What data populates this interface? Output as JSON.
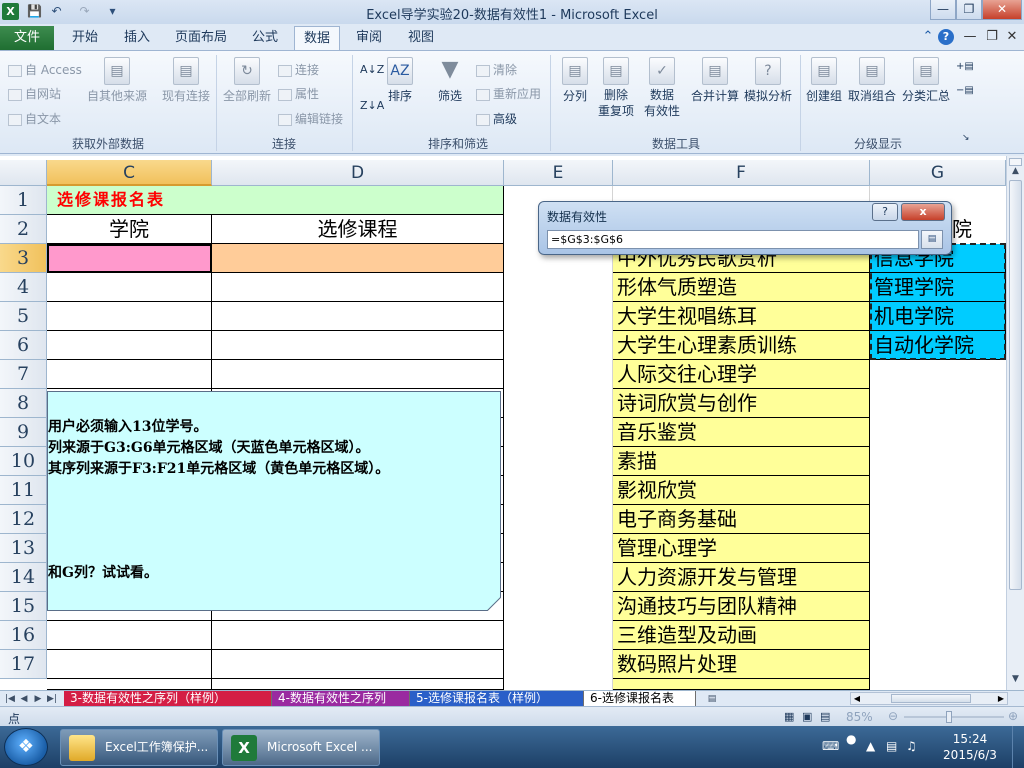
{
  "window": {
    "title": "Excel导学实验20-数据有效性1 - Microsoft Excel"
  },
  "ribbon_tabs": [
    "文件",
    "开始",
    "插入",
    "页面布局",
    "公式",
    "数据",
    "审阅",
    "视图"
  ],
  "active_tab": "数据",
  "ribbon": {
    "from_access": "自 Access",
    "from_web": "自网站",
    "from_text": "自文本",
    "other_sources": "自其他来源",
    "existing_connections": "现有连接",
    "group_external": "获取外部数据",
    "refresh_all": "全部刷新",
    "connections": "连接",
    "properties": "属性",
    "edit_links": "编辑链接",
    "group_connections": "连接",
    "sort": "排序",
    "filter": "筛选",
    "clear": "清除",
    "reapply": "重新应用",
    "advanced": "高级",
    "group_sort": "排序和筛选",
    "text_to_columns": "分列",
    "remove_duplicates_1": "删除",
    "remove_duplicates_2": "重复项",
    "data_validation_1": "数据",
    "data_validation_2": "有效性",
    "consolidate": "合并计算",
    "what_if": "模拟分析",
    "group_data_tools": "数据工具",
    "group": "创建组",
    "ungroup": "取消组合",
    "subtotal": "分类汇总",
    "group_outline": "分级显示"
  },
  "columns": [
    "C",
    "D",
    "E",
    "F",
    "G"
  ],
  "rows": [
    "1",
    "2",
    "3",
    "4",
    "5",
    "6",
    "7",
    "8",
    "9",
    "10",
    "11",
    "12",
    "13",
    "14",
    "15",
    "16",
    "17"
  ],
  "sheet": {
    "title_cell": "选修课报名表",
    "header_college": "学院",
    "header_course": "选修课程",
    "f_column": [
      "中外优秀民歌赏析",
      "形体气质塑造",
      "大学生视唱练耳",
      "大学生心理素质训练",
      "人际交往心理学",
      "诗词欣赏与创作",
      "音乐鉴赏",
      "素描",
      "影视欣赏",
      "电子商务基础",
      "管理心理学",
      "人力资源开发与管理",
      "沟通技巧与团队精神",
      "三维造型及动画",
      "数码照片处理"
    ],
    "g2_partial": "院",
    "g_column": [
      "信息学院",
      "管理学院",
      "机电学院",
      "自动化学院"
    ]
  },
  "note": {
    "line1": "用户必须输入13位学号。",
    "line2": "列来源于G3:G6单元格区域（天蓝色单元格区域）。",
    "line3": "其序列来源于F3:F21单元格区域（黄色单元格区域）。",
    "line4": "和G列？试试看。"
  },
  "dialog": {
    "title": "数据有效性",
    "help_btn": "?",
    "close_btn": "x",
    "formula": "=$G$3:$G$6"
  },
  "sheet_tabs": [
    "3-数据有效性之序列（样例）",
    "4-数据有效性之序列",
    "5-选修课报名表（样例）",
    "6-选修课报名表"
  ],
  "active_sheet_tab": "6-选修课报名表",
  "status": {
    "mode": "点",
    "zoom": "85%"
  },
  "taskbar": {
    "item1": "Excel工作簿保护...",
    "item2": "Microsoft Excel ...",
    "time": "15:24",
    "date": "2015/6/3"
  },
  "colors": {
    "title_row": "#ccffcc",
    "college_cell": "#ff99cc",
    "course_cell": "#ffcc99",
    "course_list": "#ffff99",
    "college_list": "#00ccff",
    "note_fill": "#ccffff",
    "title_text": "#ff0000"
  }
}
